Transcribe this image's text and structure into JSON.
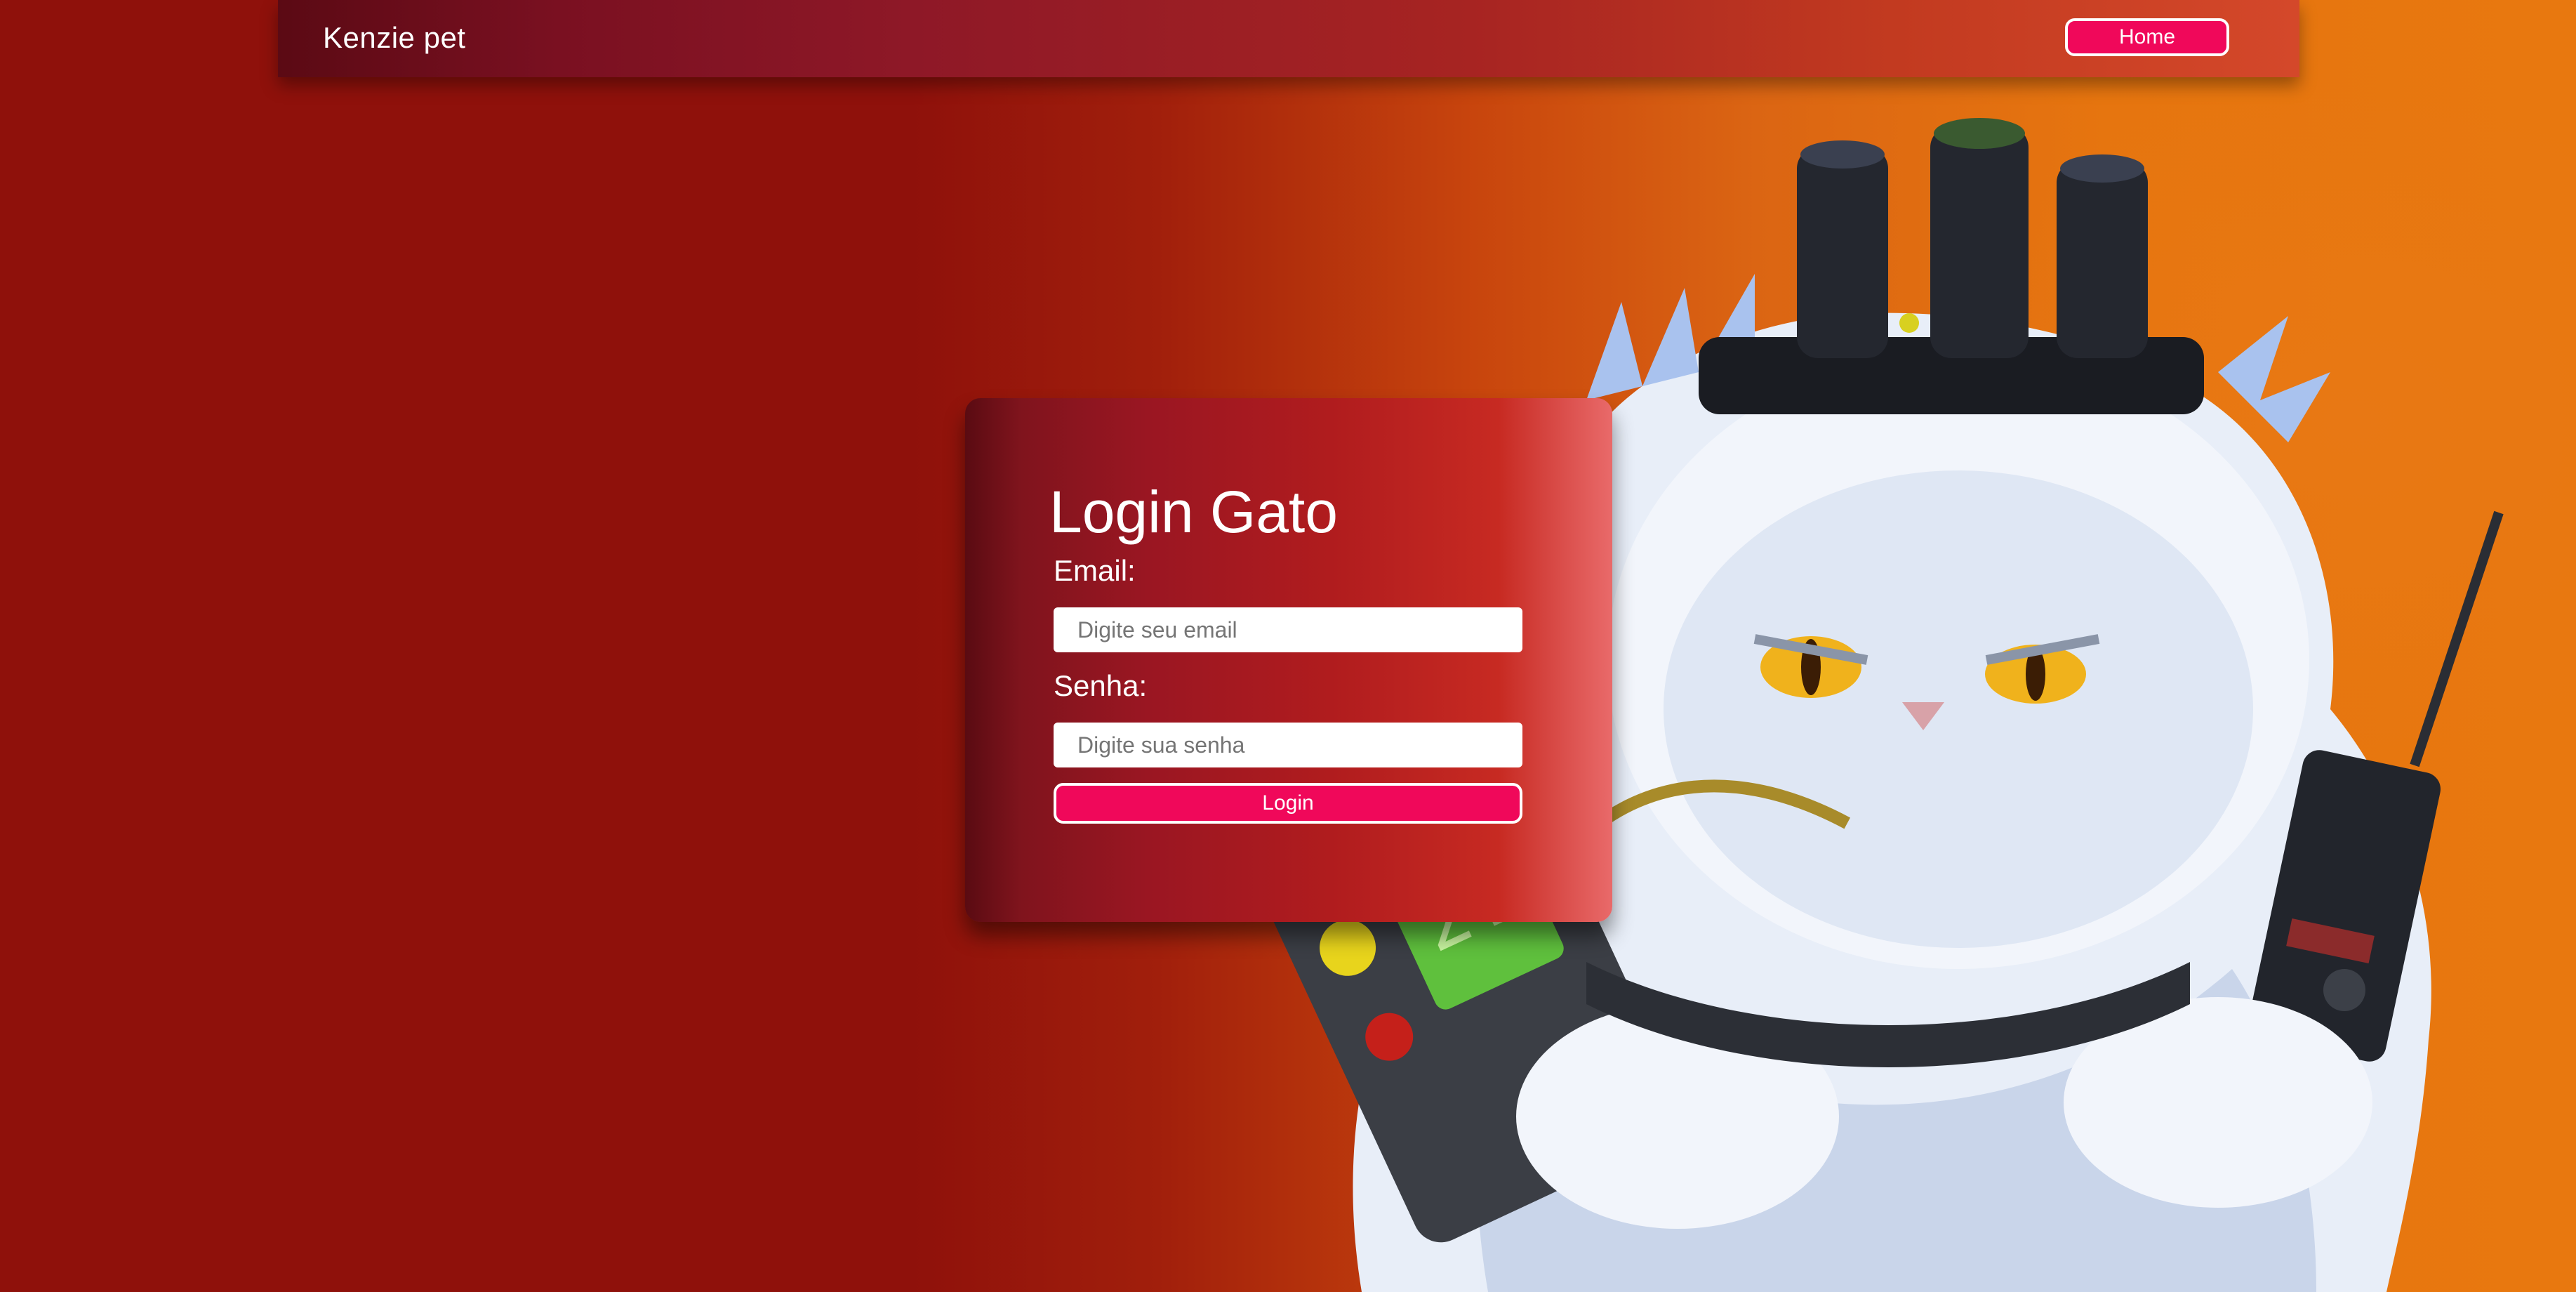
{
  "navbar": {
    "brand": "Kenzie pet",
    "home_label": "Home"
  },
  "login": {
    "title": "Login Gato",
    "email_label": "Email:",
    "email_placeholder": "Digite seu email",
    "password_label": "Senha:",
    "password_placeholder": "Digite sua senha",
    "submit_label": "Login"
  },
  "illustration": {
    "icon": "cat-with-ghost-gear-illustration"
  },
  "colors": {
    "accent_button": "#f0085a",
    "background_dark_red": "#8f110b",
    "background_orange": "#e8780f"
  }
}
